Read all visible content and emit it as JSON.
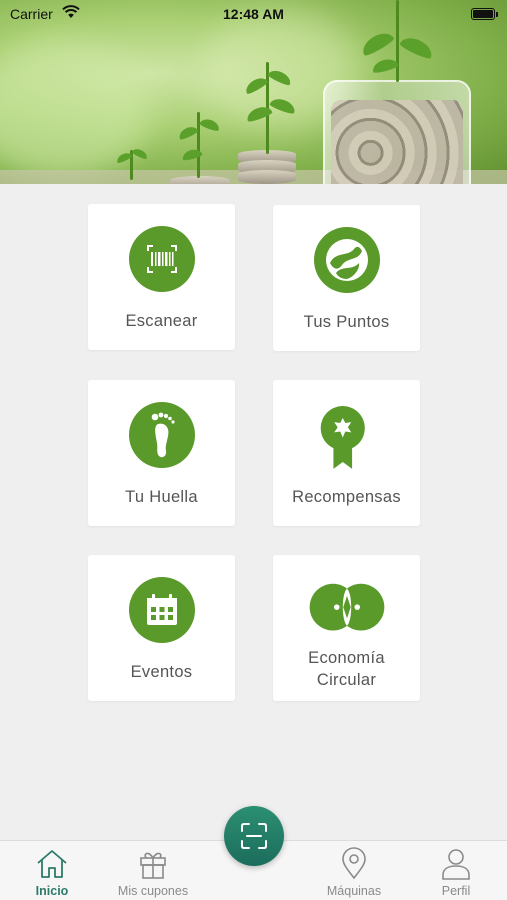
{
  "status_bar": {
    "carrier": "Carrier",
    "time": "12:48 AM"
  },
  "colors": {
    "icon_green": "#5a9a2a",
    "tab_active": "#2e7a6a",
    "tab_inactive": "#8a8a8a",
    "fab": "#237e67",
    "card_text": "#555555",
    "background": "#efefef"
  },
  "menu": {
    "items": [
      {
        "label": "Escanear",
        "icon": "barcode-scan-icon"
      },
      {
        "label": "Tus Puntos",
        "icon": "points-swirl-icon"
      },
      {
        "label": "Tu Huella",
        "icon": "footprint-icon"
      },
      {
        "label": "Recompensas",
        "icon": "award-ribbon-icon"
      },
      {
        "label": "Eventos",
        "icon": "calendar-icon"
      },
      {
        "label_line1": "Economía",
        "label_line2": "Circular",
        "icon": "circular-economy-icon"
      }
    ]
  },
  "tabbar": {
    "tabs": [
      {
        "label": "Inicio",
        "icon": "home-icon",
        "active": true
      },
      {
        "label": "Mis cupones",
        "icon": "gift-icon",
        "active": false
      },
      {
        "label": "Máquinas",
        "icon": "map-pin-icon",
        "active": false
      },
      {
        "label": "Perfil",
        "icon": "user-icon",
        "active": false
      }
    ],
    "center_button_icon": "scan-frame-icon"
  }
}
